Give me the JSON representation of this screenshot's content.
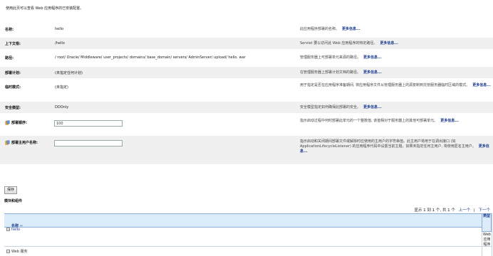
{
  "intro": "使用此页可以查看 Web 应用程序的已安装配置。",
  "more_label": "更多信息...",
  "fields": [
    {
      "label": "名称:",
      "value": "hello",
      "desc": "此应用程序部署的名称。"
    },
    {
      "label": "上下文根:",
      "value": "/hello",
      "desc": "Servlet 要以访问此 Web 应用程序的特定路径。"
    },
    {
      "label": "路径:",
      "value": "/ root/ Oracle/ Middleware/ user_projects/ domains/ base_domain/ servers/ AdminServer/ upload/ hello. war",
      "desc": "管理服务器上可部署单元来源的路径。"
    },
    {
      "label": "部署计划:",
      "value": "(未指定任何计划)",
      "desc": "在管理服务器上部署计划文档的路径。"
    },
    {
      "label": "临时模式:",
      "value": "(未指定)",
      "desc": "用于指定是否在应用程序准备期间, 将应用程序文件从管理服务器上的源复制到托管服务器临时区域的模式。"
    },
    {
      "label": "安全模型:",
      "value": "DDOnly",
      "desc": "安全模型指定如何确保此部署的安全。"
    },
    {
      "label": "部署顺序:",
      "value": "100",
      "desc": "指示启动过程中何时部署此单元的一个整数值, 该值相对于服务器上的其他可部署单元。"
    },
    {
      "label": "部署主用户名称:",
      "value": "",
      "desc": "指示启动和关闭期间部署文件或解除时应使用的主用户的字符串值。此主用户将用于在调出接口 (如 ApplicationLifecycleListener) 的应用程序代码中设置当前主题。如果未指定任何主用户, 将使用匿名主用户。"
    }
  ],
  "save_label": "保存",
  "modules_title": "模块和组件",
  "pager": {
    "text": "显示 1 到 1 个, 共 1 个",
    "prev": "上一个",
    "sep": "|",
    "next": "下一个"
  },
  "table": {
    "col_name": "名称",
    "col_type": "类型",
    "rows": [
      {
        "name": "hello",
        "type": "Web 应用程序"
      },
      {
        "name": "Web 服务",
        "type": ""
      }
    ]
  }
}
